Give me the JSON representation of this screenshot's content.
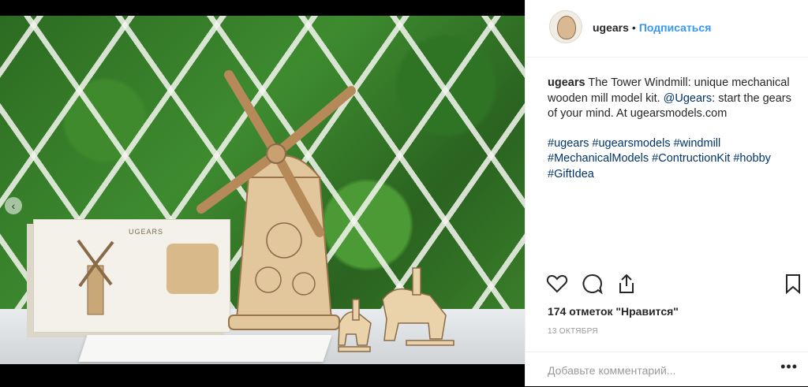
{
  "post": {
    "username": "ugears",
    "separator": "•",
    "follow_label": "Подписаться",
    "caption_username": "ugears",
    "caption_text": "The Tower Windmill: unique mechanical wooden mill model kit. ",
    "caption_mention": "@Ugears",
    "caption_rest": ": start the gears of your mind. At ugearsmodels.com",
    "hashtags": "#ugears #ugearsmodels #windmill #MechanicalModels #ContructionKit #hobby #GiftIdea",
    "likes": "174 отметок \"Нравится\"",
    "date": "13 ОКТЯБРЯ",
    "comment_placeholder": "Добавьте комментарий...",
    "more_label": "•••"
  },
  "photo": {
    "box_brand": "UGEARS",
    "prev_label": "‹",
    "slide_count": 2,
    "active_slide": 2
  },
  "icons": {
    "like": "heart-icon",
    "comment": "comment-icon",
    "share": "share-icon",
    "save": "bookmark-icon",
    "avatar": "avatar-icon",
    "prev": "chevron-left-icon"
  },
  "colors": {
    "accent": "#3897f0",
    "link": "#003569",
    "text": "#262626",
    "muted": "#999999"
  }
}
